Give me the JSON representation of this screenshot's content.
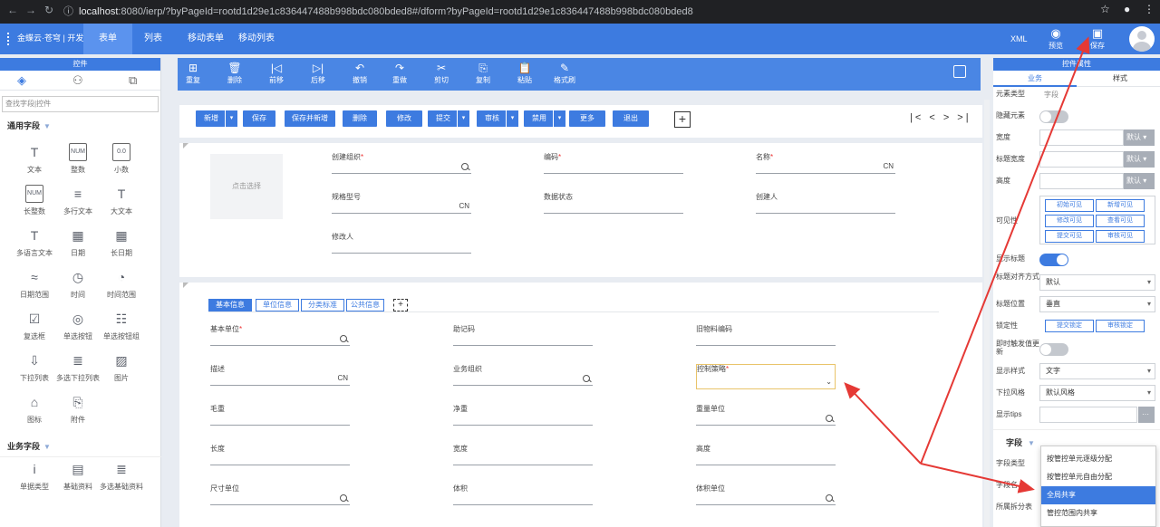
{
  "browser": {
    "url_host": "localhost",
    "url_rest": ":8080/ierp/?byPageId=rootd1d29e1c836447488b998bdc080bded8#/dform?byPageId=rootd1d29e1c836447488b998bdc080bded8"
  },
  "header": {
    "logo_text": "金蝶云·苍穹 | 开发平台",
    "tabs": [
      "表单",
      "列表",
      "移动表单",
      "移动列表"
    ],
    "xml_label": "XML",
    "preview_label": "预览",
    "save_label": "保存"
  },
  "left_panel": {
    "title": "控件",
    "search_placeholder": "查找字段|控件",
    "groups": [
      {
        "name": "通用字段",
        "items": [
          "文本",
          "整数",
          "小数",
          "长整数",
          "多行文本",
          "大文本",
          "多语言文本",
          "日期",
          "长日期",
          "日期范围",
          "时间",
          "时间范围",
          "复选框",
          "单选按钮",
          "单选按钮组",
          "下拉列表",
          "多选下拉列表",
          "图片",
          "图标",
          "附件"
        ],
        "glyphs": [
          "T",
          "NUM",
          "0.0",
          "NUM",
          "≡",
          "T",
          "T",
          "▦",
          "▦",
          "≈",
          "◷",
          "◔",
          "☑",
          "◎",
          "☷",
          "⇩",
          "≣",
          "▨",
          "⌂",
          "⎘"
        ]
      },
      {
        "name": "业务字段",
        "items": [
          "单据类型",
          "基础资料",
          "多选基础资料"
        ],
        "glyphs": [
          "i",
          "▤",
          "≣"
        ]
      }
    ]
  },
  "toolbar": {
    "items": [
      "重复",
      "删除",
      "前移",
      "后移",
      "撤销",
      "重做",
      "剪切",
      "复制",
      "粘贴",
      "格式刷"
    ],
    "glyphs": [
      "⊞",
      "🗑",
      "|◁",
      "▷|",
      "↶",
      "↷",
      "✂",
      "⎘",
      "📋",
      "✎"
    ]
  },
  "form": {
    "buttons": [
      "新增",
      "保存",
      "保存并新增",
      "删除",
      "修改",
      "提交",
      "审核",
      "禁用",
      "更多",
      "退出"
    ],
    "pager": "|< < > >|",
    "photo_hint": "点击选择",
    "header_fields": [
      {
        "label": "创建组织",
        "required": true,
        "suffix": "search"
      },
      {
        "label": "编码",
        "required": true,
        "suffix": ""
      },
      {
        "label": "名称",
        "required": true,
        "suffix": "CN"
      },
      {
        "label": "规格型号",
        "required": false,
        "suffix": "CN"
      },
      {
        "label": "数据状态",
        "required": false,
        "suffix": ""
      },
      {
        "label": "创建人",
        "required": false,
        "suffix": ""
      },
      {
        "label": "修改人",
        "required": false,
        "suffix": ""
      }
    ],
    "subtabs": [
      "基本信息",
      "单位信息",
      "分类标准",
      "公共信息"
    ],
    "body_fields": [
      {
        "label": "基本单位",
        "required": true,
        "suffix": "search"
      },
      {
        "label": "助记码",
        "required": false,
        "suffix": ""
      },
      {
        "label": "旧物料编码",
        "required": false,
        "suffix": ""
      },
      {
        "label": "描述",
        "required": false,
        "suffix": "CN"
      },
      {
        "label": "业务组织",
        "required": false,
        "suffix": "search"
      },
      {
        "label": "控制策略",
        "required": true,
        "suffix": "chevron"
      },
      {
        "label": "毛重",
        "required": false,
        "suffix": ""
      },
      {
        "label": "净重",
        "required": false,
        "suffix": ""
      },
      {
        "label": "重量单位",
        "required": false,
        "suffix": "search"
      },
      {
        "label": "长度",
        "required": false,
        "suffix": ""
      },
      {
        "label": "宽度",
        "required": false,
        "suffix": ""
      },
      {
        "label": "高度",
        "required": false,
        "suffix": ""
      },
      {
        "label": "尺寸单位",
        "required": false,
        "suffix": "search"
      },
      {
        "label": "体积",
        "required": false,
        "suffix": ""
      },
      {
        "label": "体积单位",
        "required": false,
        "suffix": "search"
      }
    ]
  },
  "right_panel": {
    "title": "控件属性",
    "tabs": [
      "业务",
      "样式"
    ],
    "element_type_label": "元素类型",
    "element_type_value": "字段",
    "hide_label": "隐藏元素",
    "width_label": "宽度",
    "title_width_label": "标题宽度",
    "height_label": "高度",
    "default_label": "默认",
    "visible_label": "可见性",
    "visible_options": [
      "初始可见",
      "新增可见",
      "修改可见",
      "查看可见",
      "提交可见",
      "审核可见"
    ],
    "show_title_label": "显示标题",
    "title_align_label": "标题对齐方式",
    "title_align_value": "默认",
    "title_pos_label": "标题位置",
    "title_pos_value": "垂直",
    "lock_label": "锁定性",
    "lock_options": [
      "提交锁定",
      "审核锁定"
    ],
    "instant_label": "即时触发值更新",
    "display_style_label": "显示样式",
    "display_style_value": "文字",
    "dropdown_style_label": "下拉风格",
    "dropdown_style_value": "默认风格",
    "tips_label": "显示tips",
    "tips_button": "···",
    "field_section": "字段",
    "field_type_label": "字段类型",
    "field_name_label": "字段名",
    "split_table_label": "所属拆分表",
    "dropdown_options": [
      "按管控单元逐级分配",
      "按管控单元自由分配",
      "全局共享",
      "管控范围内共享"
    ],
    "dropdown_selected_index": 2
  },
  "colors": {
    "brand": "#3d7be0",
    "annotation_arrow": "#e53935"
  }
}
